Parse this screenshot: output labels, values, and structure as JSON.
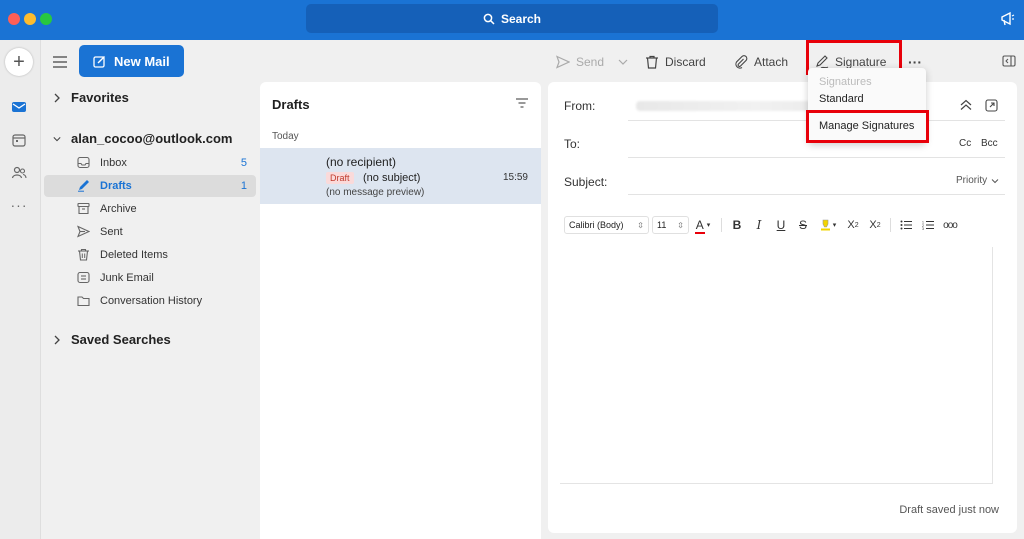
{
  "search": {
    "label": "Search"
  },
  "compose_button": {
    "label": "New Mail"
  },
  "folders": {
    "favorites_label": "Favorites",
    "account": "alan_cocoo@outlook.com",
    "items": [
      {
        "label": "Inbox",
        "count": "5",
        "icon": "inbox-icon"
      },
      {
        "label": "Drafts",
        "count": "1",
        "icon": "drafts-icon"
      },
      {
        "label": "Archive",
        "count": "",
        "icon": "archive-icon"
      },
      {
        "label": "Sent",
        "count": "",
        "icon": "sent-icon"
      },
      {
        "label": "Deleted Items",
        "count": "",
        "icon": "trash-icon"
      },
      {
        "label": "Junk Email",
        "count": "",
        "icon": "junk-icon"
      },
      {
        "label": "Conversation History",
        "count": "",
        "icon": "folder-icon"
      }
    ],
    "saved_searches_label": "Saved Searches"
  },
  "message_list": {
    "title": "Drafts",
    "group": "Today",
    "items": [
      {
        "to": "(no recipient)",
        "badge": "Draft",
        "subject": "(no subject)",
        "time": "15:59",
        "preview": "(no message preview)"
      }
    ]
  },
  "toolbar": {
    "send": "Send",
    "discard": "Discard",
    "attach": "Attach",
    "signature": "Signature",
    "more": "···"
  },
  "compose": {
    "from_label": "From:",
    "to_label": "To:",
    "subject_label": "Subject:",
    "cc": "Cc",
    "bcc": "Bcc",
    "priority": "Priority",
    "font_family": "Calibri (Body)",
    "font_size": "11",
    "status": "Draft saved just now"
  },
  "signature_menu": {
    "header": "Signatures",
    "standard": "Standard",
    "manage": "Manage Signatures"
  },
  "colors": {
    "accent": "#1a73d4",
    "highlight_box": "#e8000a",
    "draft_badge": "#fadada"
  }
}
